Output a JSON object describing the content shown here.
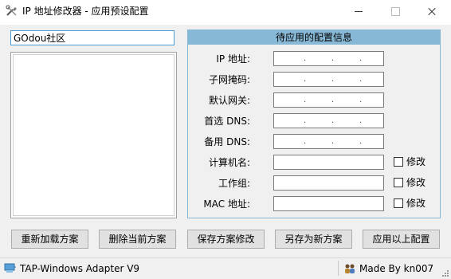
{
  "window": {
    "title": "IP 地址修改器 - 应用预设配置",
    "app_icon": "tools-icon",
    "controls": [
      "minimize-icon",
      "maximize-icon",
      "close-icon"
    ]
  },
  "left": {
    "search_value": "GOdou社区",
    "list_items": []
  },
  "panel": {
    "title": "待应用的配置信息",
    "fields": {
      "ip_label": "IP 地址:",
      "mask_label": "子网掩码:",
      "gateway_label": "默认网关:",
      "dns1_label": "首选 DNS:",
      "dns2_label": "备用 DNS:",
      "computer_label": "计算机名:",
      "workgroup_label": "工作组:",
      "mac_label": "MAC 地址:"
    },
    "checkbox_label": "修改",
    "ip_dot": "."
  },
  "buttons": {
    "reload": "重新加载方案",
    "delete": "删除当前方案",
    "save": "保存方案修改",
    "save_as": "另存为新方案",
    "apply": "应用以上配置"
  },
  "status": {
    "adapter": "TAP-Windows Adapter V9",
    "author": "Made By kn007",
    "adapter_icon": "network-adapter-icon",
    "author_icon": "people-icon"
  }
}
